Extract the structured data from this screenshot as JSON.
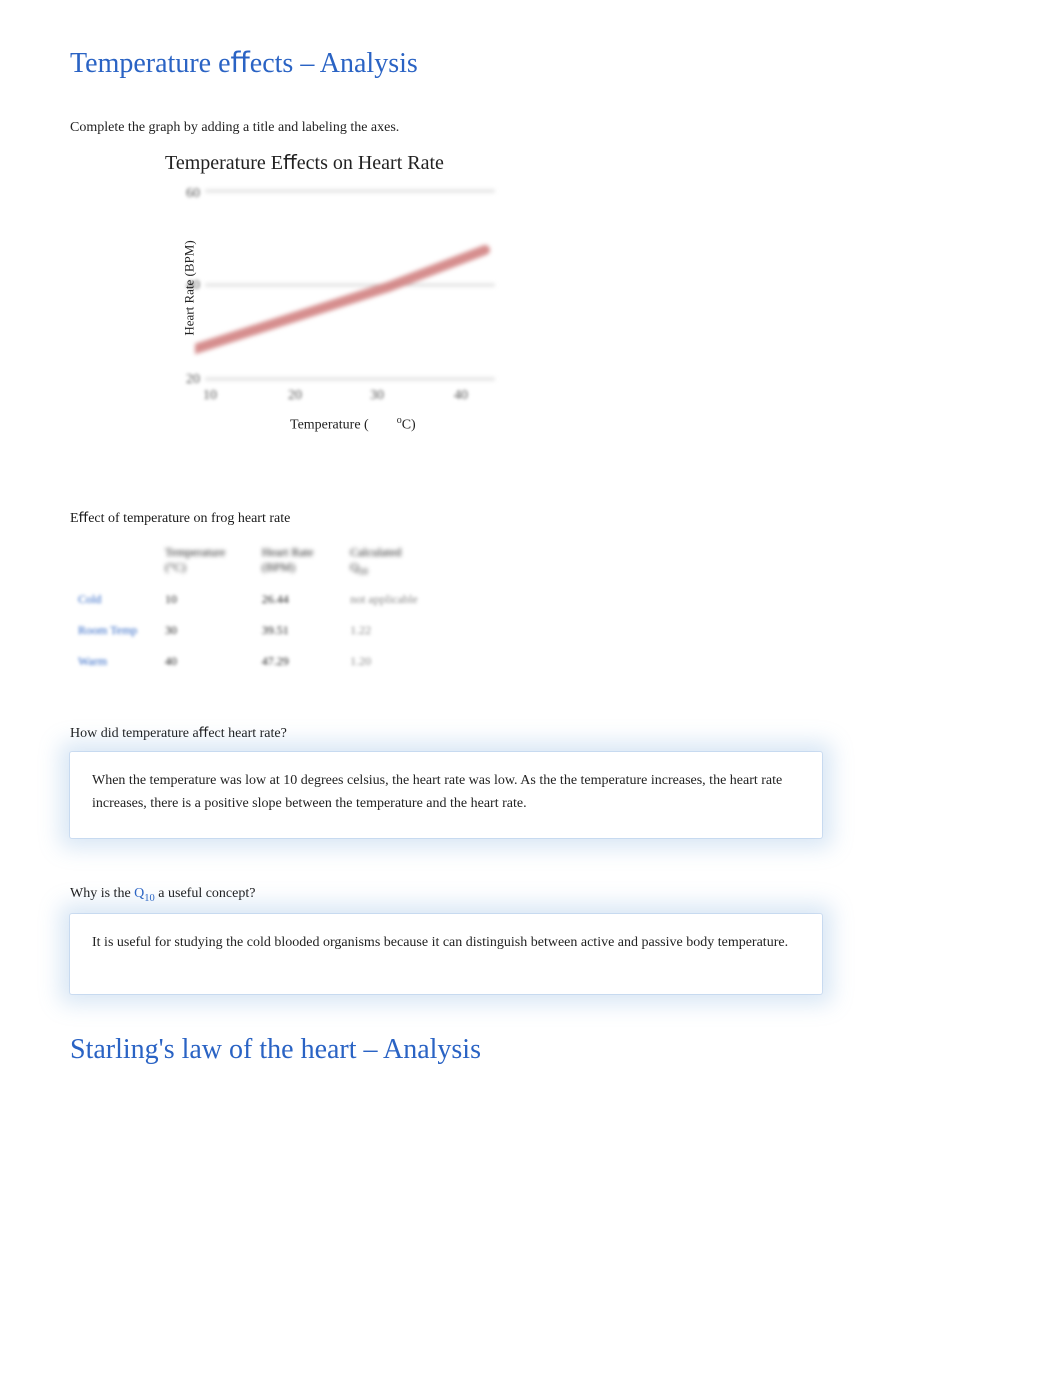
{
  "section1_title": "Temperature eﬀects – Analysis",
  "instruction1": "Complete the graph by adding a title and labeling the axes.",
  "chart_data": {
    "type": "line",
    "title": "Temperature Eﬀects on Heart Rate",
    "xlabel": "Temperature (    °C)",
    "ylabel": "Heart Rate (BPM)",
    "xlim": [
      10,
      40
    ],
    "ylim": [
      20,
      60
    ],
    "y_ticks": [
      20,
      40,
      60
    ],
    "x_ticks": [
      10,
      20,
      30,
      40
    ],
    "series": [
      {
        "name": "Heart Rate",
        "x": [
          10,
          30,
          40
        ],
        "y": [
          26.44,
          39.51,
          47.29
        ]
      }
    ]
  },
  "table_caption": "Eﬀect of temperature on frog heart rate",
  "table": {
    "headers": [
      "",
      "Temperature (°C)",
      "Heart Rate (BPM)",
      "Calculated Q10"
    ],
    "rows": [
      {
        "label": "Cold",
        "temp": "10",
        "hr": "26.44",
        "q10": "not applicable",
        "muted": true
      },
      {
        "label": "Room Temp",
        "temp": "30",
        "hr": "39.51",
        "q10": "1.22",
        "muted": true
      },
      {
        "label": "Warm",
        "temp": "40",
        "hr": "47.29",
        "q10": "1.20",
        "muted": true
      }
    ]
  },
  "q1": "How did temperature aﬀect heart rate?",
  "a1": "When the temperature was low at 10 degrees celsius, the heart rate was low. As the the temperature increases, the heart rate increases, there is a positive slope between the temperature and the heart rate.",
  "q2_before": "Why is the ",
  "q2_q10": "Q10",
  "q2_after": " a useful concept?",
  "a2": "It is useful for studying the cold blooded organisms because it can distinguish between active and passive body temperature.",
  "section2_title": "Starling's law of the heart – Analysis"
}
